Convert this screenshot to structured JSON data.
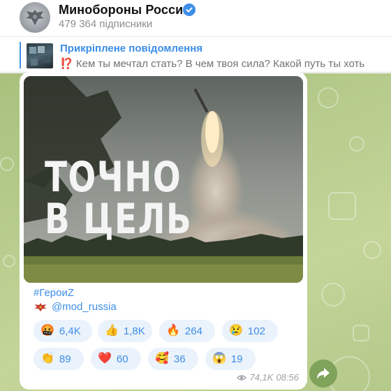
{
  "header": {
    "channel_title": "Минобороны России",
    "subscribers": "479 364 підписники",
    "avatar_icon": "ministry-emblem-icon",
    "verified_icon": "verified-badge-icon"
  },
  "pinned": {
    "title": "Прикріплене повідомлення",
    "mark": "⁉️",
    "text": "Кем ты мечтал стать? В чем твоя сила? Какой путь ты хоть"
  },
  "message": {
    "photo_text_line1": "ТОЧНО",
    "photo_text_line2": "В ЦЕЛЬ",
    "hashtag": "#ГероиZ",
    "handle": "@mod_russia",
    "reactions": [
      {
        "emoji": "🤬",
        "count": "6,4K"
      },
      {
        "emoji": "👍",
        "count": "1,8K"
      },
      {
        "emoji": "🔥",
        "count": "264"
      },
      {
        "emoji": "😢",
        "count": "102"
      },
      {
        "emoji": "👏",
        "count": "89"
      },
      {
        "emoji": "❤️",
        "count": "60"
      },
      {
        "emoji": "🥰",
        "count": "36"
      },
      {
        "emoji": "😱",
        "count": "19"
      }
    ],
    "views": "74,1K",
    "time": "08:56"
  },
  "colors": {
    "accent": "#3d8ee8",
    "chat_bg": "#b7cc8d",
    "reaction_bg": "#eaf2fb",
    "share_button": "#7fa35a"
  }
}
